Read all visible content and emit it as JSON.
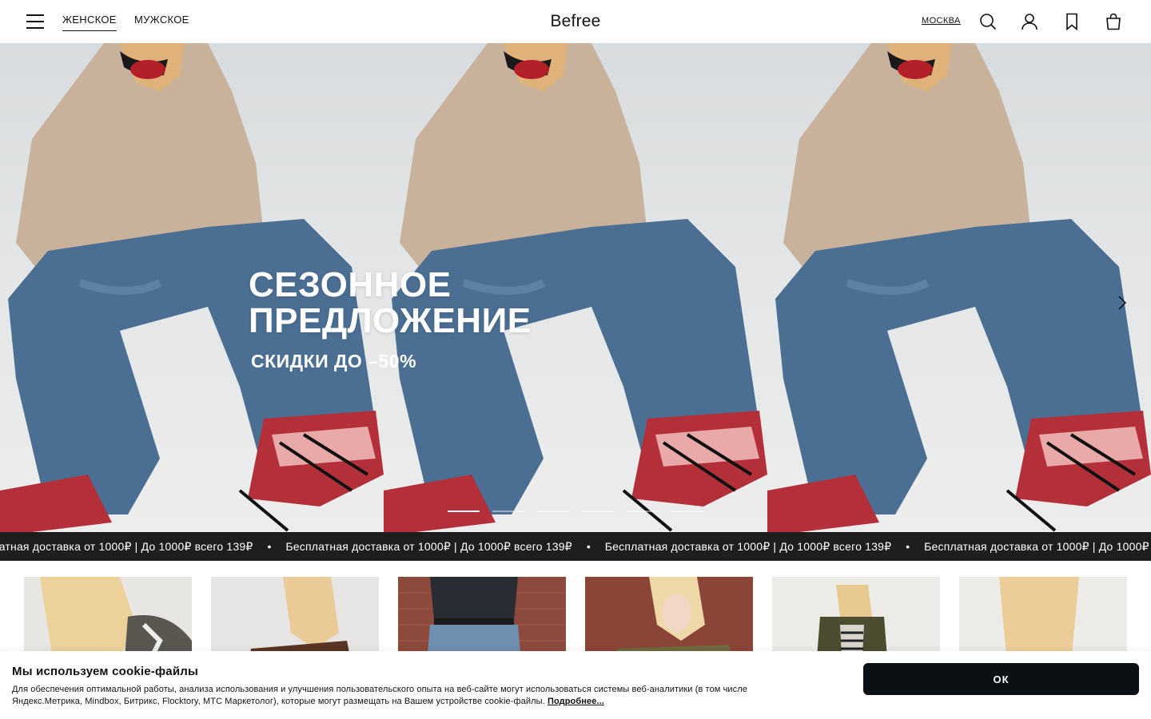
{
  "header": {
    "menu_icon": "hamburger-menu-icon",
    "tabs": [
      {
        "label": "ЖЕНСКОЕ",
        "active": true
      },
      {
        "label": "МУЖСКОЕ",
        "active": false
      }
    ],
    "logo": "Befree",
    "city": "МОСКВА",
    "icons": [
      "search-icon",
      "account-icon",
      "bookmark-icon",
      "shopping-bag-icon"
    ]
  },
  "hero": {
    "title_line1": "СЕЗОННОЕ",
    "title_line2": "ПРЕДЛОЖЕНИЕ",
    "subtitle": "СКИДКИ ДО –50%",
    "slide_count": 6,
    "active_slide": 1,
    "next_icon": "chevron-right-icon"
  },
  "marquee": {
    "items": [
      "Бесплатная доставка от 1000₽ | До 1000₽ всего 139₽",
      "Бесплатная доставка от 1000₽ | До 1000₽ всего 139₽",
      "Бесплатная доставка от 1000₽ | До 1000₽ всего 139₽",
      "Бесплатная доставка от 1000₽ | До 1000₽ всего 139₽"
    ],
    "separator": "•"
  },
  "categories": {
    "count": 6
  },
  "cookie": {
    "title": "Мы используем cookie-файлы",
    "text": "Для обеспечения оптимальной работы, анализа использования и улучшения пользовательского опыта на веб-сайте могут использоваться системы веб-аналитики (в том числе Яндекс.Метрика, Mindbox, Битрикс, Flocktory, МТС Маркетолог), которые могут размещать на Вашем устройстве cookie-файлы.",
    "link": "Подробнее...",
    "ok_label": "ОК"
  },
  "colors": {
    "marquee_bg": "#1c1e1f",
    "button_bg": "#0b1014",
    "jeans": "#4b6f93",
    "blazer": "#c9b29b",
    "sneaker": "#b3303a"
  }
}
